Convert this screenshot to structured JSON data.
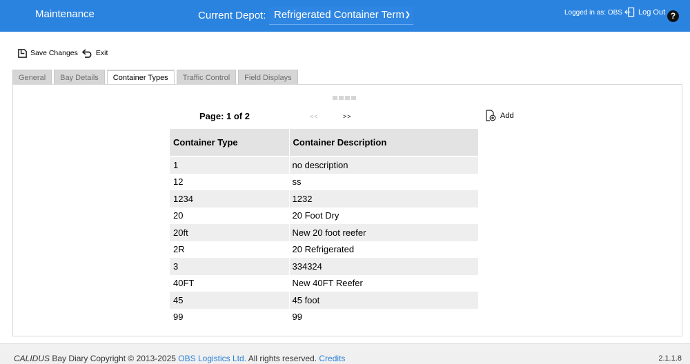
{
  "header": {
    "app_title": "Maintenance",
    "depot_label": "Current Depot:",
    "depot_value": "Refrigerated Container Term",
    "logged_in_as": "Logged in as: OBS",
    "logout_label": "Log Out",
    "help_label": "?"
  },
  "toolbar": {
    "save_label": "Save Changes",
    "exit_label": "Exit"
  },
  "tabs": [
    {
      "label": "General",
      "active": false
    },
    {
      "label": "Bay Details",
      "active": false
    },
    {
      "label": "Container Types",
      "active": true
    },
    {
      "label": "Traffic Control",
      "active": false
    },
    {
      "label": "Field Displays",
      "active": false
    }
  ],
  "pager": {
    "page_info": "Page: 1 of 2",
    "prev_label": "<<",
    "next_label": ">>",
    "add_label": "Add"
  },
  "table": {
    "columns": [
      "Container Type",
      "Container Description"
    ],
    "rows": [
      [
        "1",
        "no description"
      ],
      [
        "12",
        "ss"
      ],
      [
        "1234",
        "1232"
      ],
      [
        "20",
        "20 Foot Dry"
      ],
      [
        "20ft",
        "New 20 foot reefer"
      ],
      [
        "2R",
        "20 Refrigerated"
      ],
      [
        "3",
        "334324"
      ],
      [
        "40FT",
        "New 40FT Reefer"
      ],
      [
        "45",
        "45 foot"
      ],
      [
        "99",
        "99"
      ]
    ]
  },
  "footer": {
    "brand": "CALIDUS",
    "copy_text": " Bay Diary Copyright © 2013-2025 ",
    "company_link": "OBS Logistics Ltd.",
    "rights_text": " All rights reserved. ",
    "credits_link": "Credits",
    "version": "2.1.1.8"
  },
  "colors": {
    "header_bg": "#2b83e0",
    "active_tab_accent": "#6fdc4b",
    "link": "#2b7fd6"
  }
}
